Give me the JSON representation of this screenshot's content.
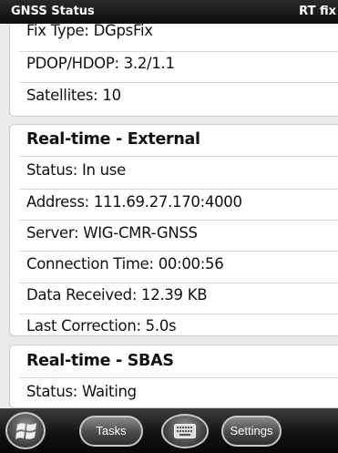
{
  "titlebar": {
    "title": "GNSS Status",
    "right_label": "RT fix"
  },
  "sections": {
    "fix": {
      "rows": [
        "Fix Type: DGpsFix",
        "PDOP/HDOP: 3.2/1.1",
        "Satellites: 10"
      ]
    },
    "realtime_external": {
      "title": "Real-time - External",
      "rows": [
        "Status: In use",
        "Address: 111.69.27.170:4000",
        "Server: WIG-CMR-GNSS",
        "Connection Time: 00:00:56",
        "Data Received: 12.39 KB",
        "Last Correction: 5.0s"
      ]
    },
    "realtime_sbas": {
      "title": "Real-time - SBAS",
      "rows": [
        "Status: Waiting"
      ]
    }
  },
  "taskbar": {
    "start_icon": "windows-flag-icon",
    "tasks_label": "Tasks",
    "keyboard_icon": "keyboard-icon",
    "settings_label": "Settings"
  }
}
